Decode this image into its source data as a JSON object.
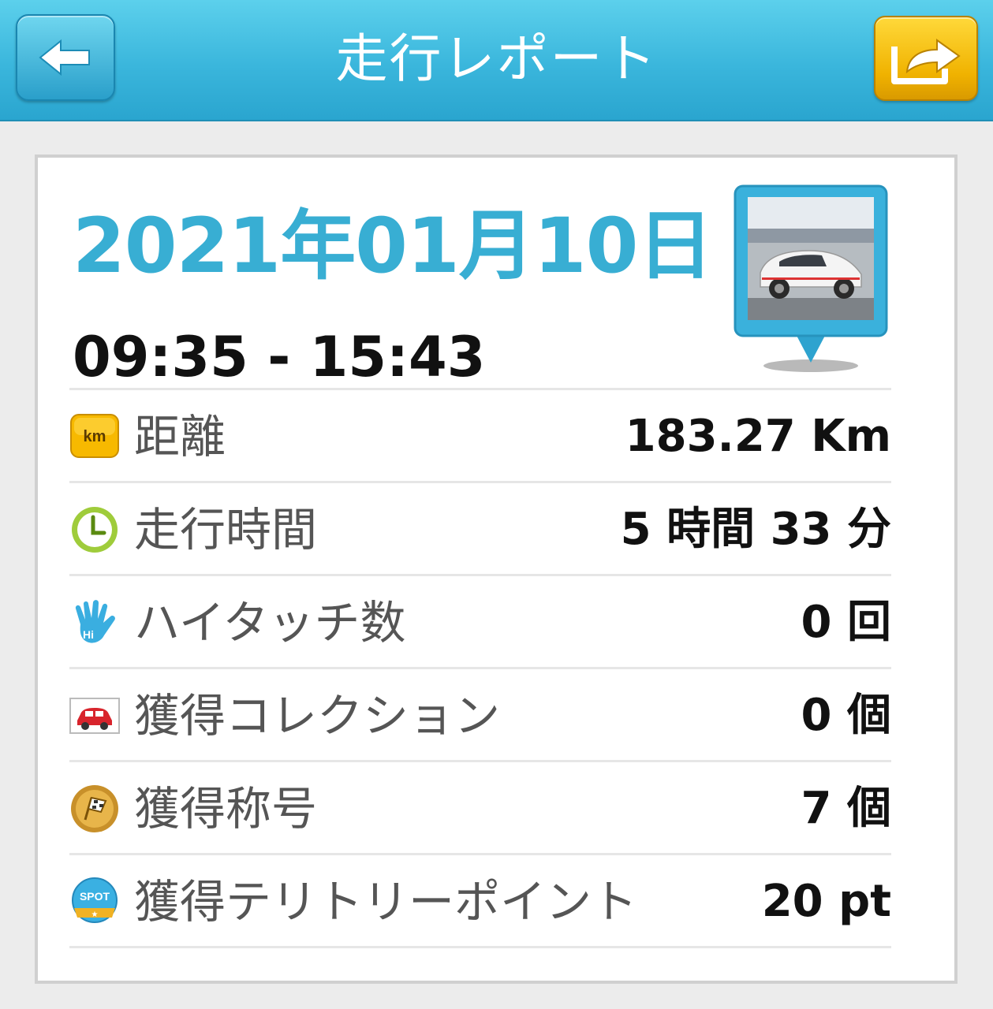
{
  "header": {
    "title": "走行レポート",
    "back_icon": "arrow-left-icon",
    "share_icon": "share-arrow-icon",
    "color_primary": "#38aed3",
    "color_share": "#f0b200"
  },
  "report": {
    "date": "2021年01月10日",
    "time_range": "09:35 - 15:43",
    "photo_subject": "white car photo"
  },
  "stats": [
    {
      "icon": "km-badge-icon",
      "label": "距離",
      "value": "183.27 Km"
    },
    {
      "icon": "clock-icon",
      "label": "走行時間",
      "value": "5 時間 33 分"
    },
    {
      "icon": "high-five-hand-icon",
      "label": "ハイタッチ数",
      "value": "0 回"
    },
    {
      "icon": "red-car-card-icon",
      "label": "獲得コレクション",
      "value": "0 個"
    },
    {
      "icon": "gold-medal-flag-icon",
      "label": "獲得称号",
      "value": "7 個"
    },
    {
      "icon": "spot-badge-icon",
      "label": "獲得テリトリーポイント",
      "value": "20 pt"
    }
  ]
}
